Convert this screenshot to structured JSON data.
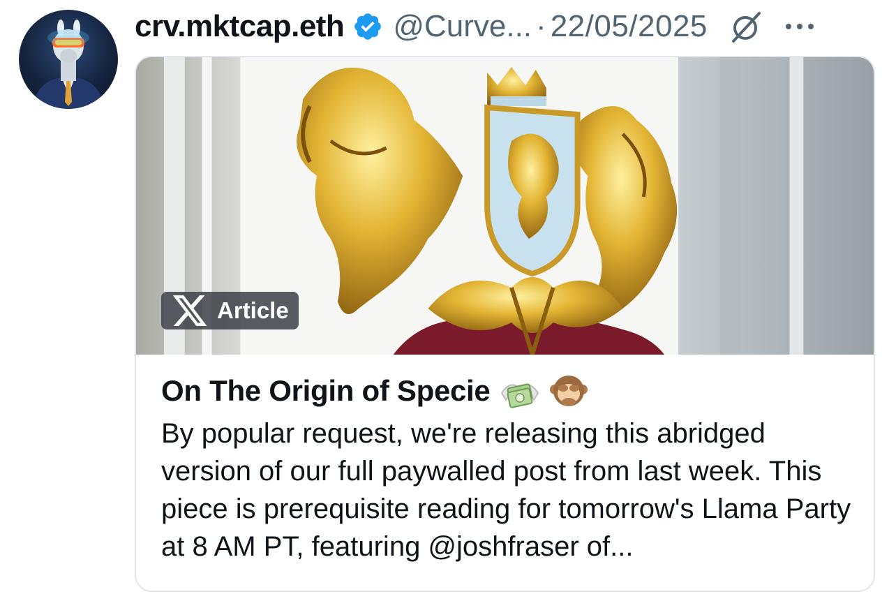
{
  "tweet": {
    "display_name": "crv.mktcap.eth",
    "handle": "@Curve...",
    "separator": "·",
    "date": "22/05/2025",
    "icons": {
      "verified": "verified-badge-icon",
      "grok": "grok-icon",
      "more": "more-options-icon"
    }
  },
  "article": {
    "badge_label": "Article",
    "title": "On The Origin of Specie",
    "title_emojis": [
      "money-with-wings-icon",
      "see-no-evil-monkey-icon"
    ],
    "body": "By popular request, we're releasing this abridged version of our full paywalled post from last week. This piece is prerequisite reading for tomorrow's Llama Party at 8 AM PT, featuring @joshfraser of..."
  },
  "colors": {
    "verified_blue": "#1d9bf0",
    "secondary_text": "#536471",
    "primary_text": "#0f1419",
    "border": "#e1e6ea"
  }
}
